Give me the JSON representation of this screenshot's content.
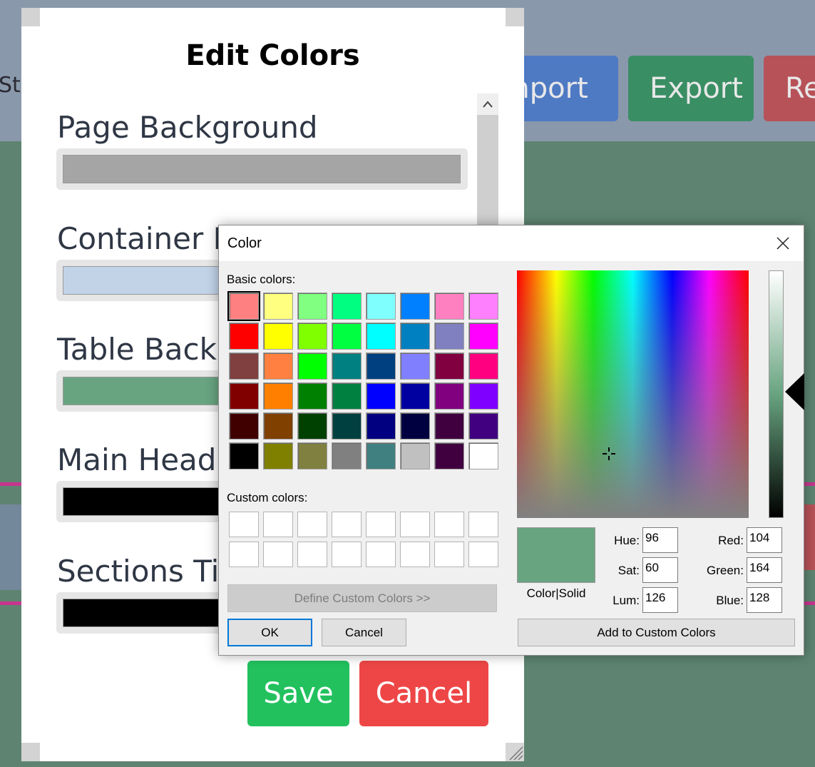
{
  "background": {
    "partial_label_left": "Sto",
    "buttons": {
      "import": "Import",
      "export": "Export",
      "reset": "Re"
    }
  },
  "modal": {
    "title": "Edit Colors",
    "fields": [
      {
        "label": "Page Background",
        "color": "#a5a5a5"
      },
      {
        "label": "Container Ba",
        "color": "#c2d3e8"
      },
      {
        "label": "Table Backgr",
        "color": "#68a480"
      },
      {
        "label": "Main Headin",
        "color": "#000000"
      },
      {
        "label": "Sections Titl",
        "color": "#000000"
      }
    ],
    "save_label": "Save",
    "cancel_label": "Cancel"
  },
  "color_dialog": {
    "title": "Color",
    "basic_colors_label": "Basic colors:",
    "custom_colors_label": "Custom colors:",
    "define_custom_label": "Define Custom Colors >>",
    "ok_label": "OK",
    "cancel_label": "Cancel",
    "add_custom_label": "Add to Custom Colors",
    "preview_label": "Color|Solid",
    "preview_color": "#68a480",
    "selected_basic_index": 0,
    "basic_colors": [
      "#ff8080",
      "#ffff80",
      "#80ff80",
      "#00ff80",
      "#80ffff",
      "#0080ff",
      "#ff80c0",
      "#ff80ff",
      "#ff0000",
      "#ffff00",
      "#80ff00",
      "#00ff40",
      "#00ffff",
      "#0080c0",
      "#8080c0",
      "#ff00ff",
      "#804040",
      "#ff8040",
      "#00ff00",
      "#008080",
      "#004080",
      "#8080ff",
      "#800040",
      "#ff0080",
      "#800000",
      "#ff8000",
      "#008000",
      "#008040",
      "#0000ff",
      "#0000a0",
      "#800080",
      "#8000ff",
      "#400000",
      "#804000",
      "#004000",
      "#004040",
      "#000080",
      "#000040",
      "#400040",
      "#400080",
      "#000000",
      "#808000",
      "#808040",
      "#808080",
      "#408080",
      "#c0c0c0",
      "#400040",
      "#ffffff"
    ],
    "custom_colors_count": 16,
    "values": {
      "hue_label": "Hue:",
      "hue": "96",
      "sat_label": "Sat:",
      "sat": "60",
      "lum_label": "Lum:",
      "lum": "126",
      "red_label": "Red:",
      "red": "104",
      "green_label": "Green:",
      "green": "164",
      "blue_label": "Blue:",
      "blue": "128"
    }
  }
}
